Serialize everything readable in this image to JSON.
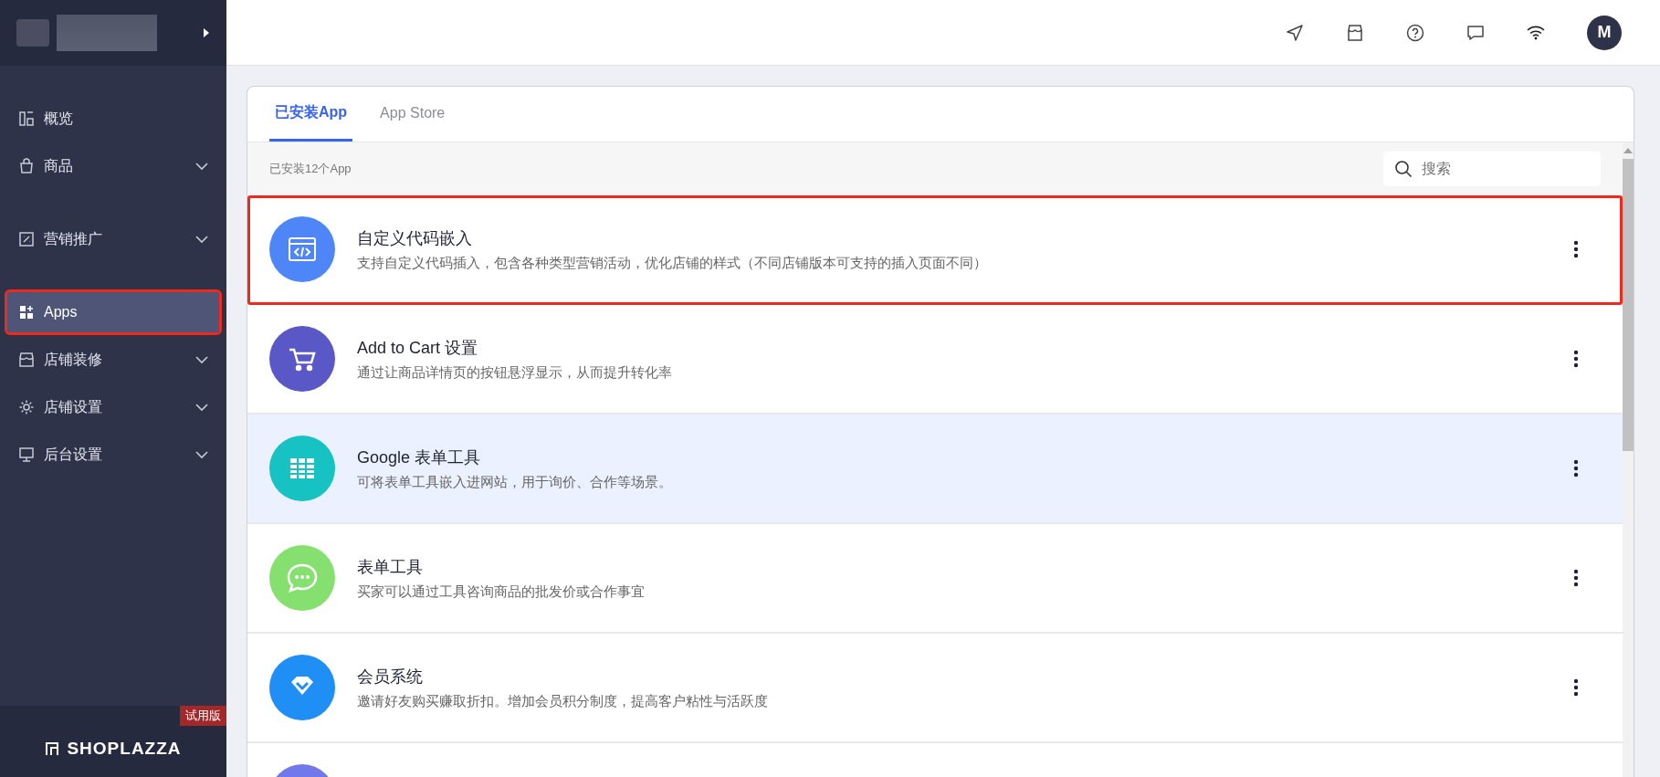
{
  "sidebar": {
    "items": [
      {
        "label": "概览",
        "expandable": false,
        "selected": false
      },
      {
        "label": "商品",
        "expandable": true,
        "selected": false
      },
      {
        "label": "营销推广",
        "expandable": true,
        "selected": false
      },
      {
        "label": "Apps",
        "expandable": false,
        "selected": true
      },
      {
        "label": "店铺装修",
        "expandable": true,
        "selected": false
      },
      {
        "label": "店铺设置",
        "expandable": true,
        "selected": false
      },
      {
        "label": "后台设置",
        "expandable": true,
        "selected": false
      }
    ],
    "badge": "试用版",
    "brand": "SHOPLAZZA"
  },
  "topbar": {
    "avatar": "M"
  },
  "tabs": [
    {
      "label": "已安装App",
      "selected": true
    },
    {
      "label": "App Store",
      "selected": false
    }
  ],
  "installed_count": "已安装12个App",
  "search": {
    "placeholder": "搜索"
  },
  "apps": [
    {
      "title": "自定义代码嵌入",
      "description": "支持自定义代码插入，包含各种类型营销活动，优化店铺的样式（不同店铺版本可支持的插入页面不同）",
      "color": "#4e86f7",
      "hovered": false,
      "highlighted": true
    },
    {
      "title": "Add to Cart 设置",
      "description": "通过让商品详情页的按钮悬浮显示，从而提升转化率",
      "color": "#5a57c7",
      "hovered": false,
      "highlighted": false
    },
    {
      "title": "Google 表单工具",
      "description": "可将表单工具嵌入进网站，用于询价、合作等场景。",
      "color": "#16c2c2",
      "hovered": true,
      "highlighted": false
    },
    {
      "title": "表单工具",
      "description": "买家可以通过工具咨询商品的批发价或合作事宜",
      "color": "#86e06f",
      "hovered": false,
      "highlighted": false
    },
    {
      "title": "会员系统",
      "description": "邀请好友购买赚取折扣。增加会员积分制度，提高客户粘性与活跃度",
      "color": "#1f8ff5",
      "hovered": false,
      "highlighted": false
    },
    {
      "color": "#7078ea",
      "hovered": false,
      "highlighted": false
    }
  ]
}
